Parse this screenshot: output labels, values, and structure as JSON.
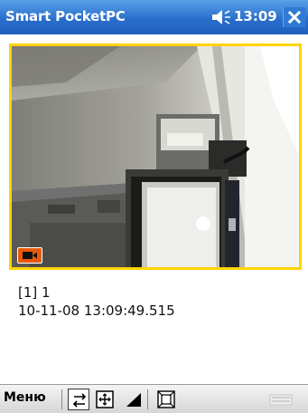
{
  "titlebar": {
    "title": "Smart PocketPC",
    "time": "13:09",
    "volume_icon": "speaker-icon",
    "close_icon": "close-icon",
    "color": "#2a6fcc"
  },
  "video": {
    "border_color": "#ffd400",
    "record_icon": "camera-icon",
    "record_color": "#e8590c"
  },
  "info": {
    "line1": "[1] 1",
    "line2": "10-11-08 13:09:49.515"
  },
  "menubar": {
    "menu_label": "Меню",
    "icons": [
      "swap-arrows-icon",
      "fit-window-icon",
      "signal-icon",
      "fullscreen-icon",
      "keyboard-icon"
    ]
  }
}
